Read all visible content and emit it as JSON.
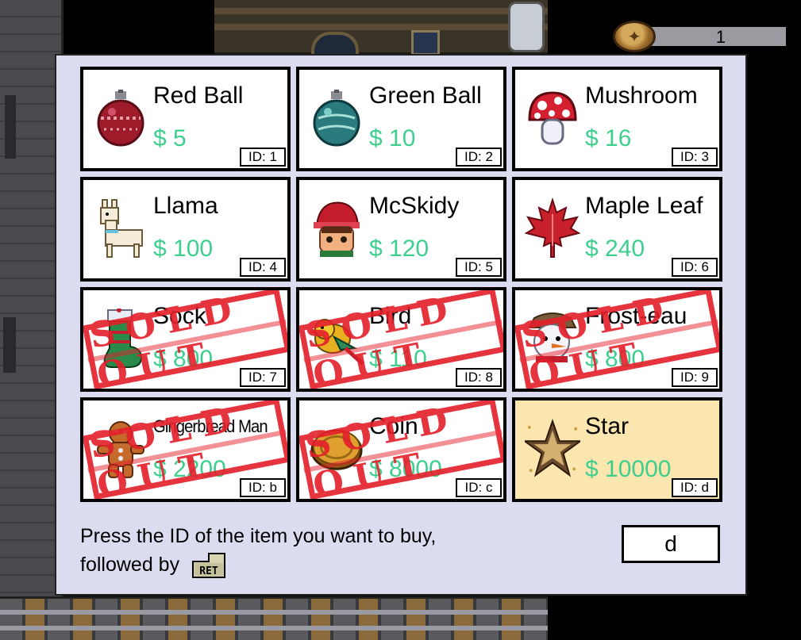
{
  "hud": {
    "coins": "1",
    "coin_icon": "coin-icon"
  },
  "shop": {
    "items": [
      {
        "name": "Red Ball",
        "price": "$ 5",
        "id": "ID: 1",
        "sold_out": false,
        "icon": "red-ornament-icon"
      },
      {
        "name": "Green Ball",
        "price": "$ 10",
        "id": "ID: 2",
        "sold_out": false,
        "icon": "green-ornament-icon"
      },
      {
        "name": "Mushroom",
        "price": "$ 16",
        "id": "ID: 3",
        "sold_out": false,
        "icon": "mushroom-icon"
      },
      {
        "name": "Llama",
        "price": "$ 100",
        "id": "ID: 4",
        "sold_out": false,
        "icon": "llama-icon"
      },
      {
        "name": "McSkidy",
        "price": "$ 120",
        "id": "ID: 5",
        "sold_out": false,
        "icon": "elf-icon"
      },
      {
        "name": "Maple Leaf",
        "price": "$ 240",
        "id": "ID: 6",
        "sold_out": false,
        "icon": "maple-leaf-icon"
      },
      {
        "name": "Sock",
        "price": "$ 800",
        "id": "ID: 7",
        "sold_out": true,
        "icon": "sock-icon"
      },
      {
        "name": "Bird",
        "price": "$ 110",
        "id": "ID: 8",
        "sold_out": true,
        "icon": "bird-icon"
      },
      {
        "name": "Frost-eau",
        "price": "$ 800",
        "id": "ID: 9",
        "sold_out": true,
        "icon": "snowman-icon"
      },
      {
        "name": "Gingerbread Man",
        "price": "$ 2200",
        "id": "ID: b",
        "sold_out": true,
        "icon": "gingerbread-icon"
      },
      {
        "name": "Coin",
        "price": "$ 8000",
        "id": "ID: c",
        "sold_out": true,
        "icon": "coin-item-icon"
      },
      {
        "name": "Star",
        "price": "$ 10000",
        "id": "ID: d",
        "sold_out": false,
        "selected": true,
        "icon": "star-icon"
      }
    ],
    "sold_out_label": "SOLD OUT"
  },
  "prompt": {
    "line1": "Press the ID of the item you want to buy,",
    "line2": "followed by",
    "key_label": "RET"
  },
  "input": {
    "value": "d"
  },
  "colors": {
    "price": "#3ecf8e",
    "stamp": "#e31f2a",
    "selected_bg": "#fbe6b0",
    "panel_bg": "#dcdcf0"
  }
}
